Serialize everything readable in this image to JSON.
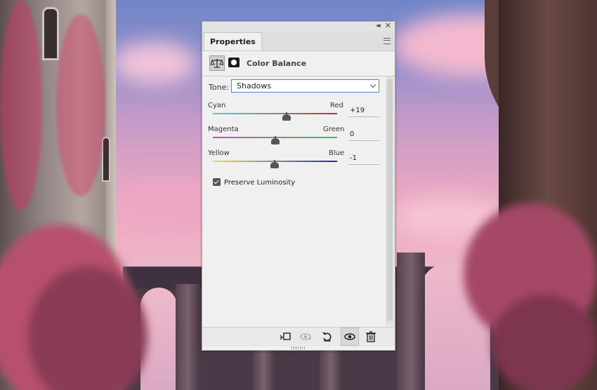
{
  "panel": {
    "tab_label": "Properties",
    "collapse_glyph": "◂◂",
    "close_glyph": "✕",
    "adjustment_title": "Color Balance",
    "icons": [
      "color-balance-icon",
      "layer-mask-icon",
      "panel-menu-icon"
    ]
  },
  "tone": {
    "label": "Tone:",
    "selected": "Shadows"
  },
  "sliders": [
    {
      "left_label": "Cyan",
      "right_label": "Red",
      "value": "+19",
      "fraction": 0.594,
      "gradient": [
        "#36d8d8",
        "#cc2a2a"
      ]
    },
    {
      "left_label": "Magenta",
      "right_label": "Green",
      "value": "0",
      "fraction": 0.5,
      "gradient": [
        "#e03ad6",
        "#2cc83a"
      ]
    },
    {
      "left_label": "Yellow",
      "right_label": "Blue",
      "value": "-1",
      "fraction": 0.495,
      "gradient": [
        "#e8e23a",
        "#2026c0"
      ]
    }
  ],
  "preserve": {
    "label": "Preserve Luminosity",
    "checked": true
  },
  "bottom_bar": {
    "icons": [
      "clip-to-layer-icon",
      "view-previous-state-icon",
      "reset-icon",
      "visibility-eye-icon",
      "trash-icon"
    ]
  }
}
